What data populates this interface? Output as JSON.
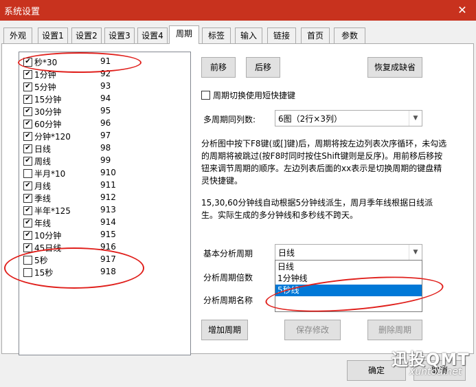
{
  "window": {
    "title": "系统设置",
    "close_glyph": "✕"
  },
  "tabs": [
    {
      "label": "外观"
    },
    {
      "label": "设置1"
    },
    {
      "label": "设置2"
    },
    {
      "label": "设置3"
    },
    {
      "label": "设置4"
    },
    {
      "label": "周期",
      "active": true
    },
    {
      "label": "标签"
    },
    {
      "label": "输入"
    },
    {
      "label": "链接"
    },
    {
      "label": "首页"
    },
    {
      "label": "参数"
    }
  ],
  "periods": [
    {
      "name": "秒*30",
      "key": "91",
      "checked": true
    },
    {
      "name": "1分钟",
      "key": "92",
      "checked": true
    },
    {
      "name": "5分钟",
      "key": "93",
      "checked": true
    },
    {
      "name": "15分钟",
      "key": "94",
      "checked": true
    },
    {
      "name": "30分钟",
      "key": "95",
      "checked": true
    },
    {
      "name": "60分钟",
      "key": "96",
      "checked": true
    },
    {
      "name": "分钟*120",
      "key": "97",
      "checked": true
    },
    {
      "name": "日线",
      "key": "98",
      "checked": true
    },
    {
      "name": "周线",
      "key": "99",
      "checked": true
    },
    {
      "name": "半月*10",
      "key": "910",
      "checked": false
    },
    {
      "name": "月线",
      "key": "911",
      "checked": true
    },
    {
      "name": "季线",
      "key": "912",
      "checked": true
    },
    {
      "name": "半年*125",
      "key": "913",
      "checked": true
    },
    {
      "name": "年线",
      "key": "914",
      "checked": true
    },
    {
      "name": "10分钟",
      "key": "915",
      "checked": true
    },
    {
      "name": "45日线",
      "key": "916",
      "checked": true
    },
    {
      "name": "5秒",
      "key": "917",
      "checked": false
    },
    {
      "name": "15秒",
      "key": "918",
      "checked": false
    }
  ],
  "buttons": {
    "move_up": "前移",
    "move_down": "后移",
    "restore_default": "恢复成缺省",
    "add_period": "增加周期",
    "save_changes": "保存修改",
    "delete_period": "删除周期",
    "ok": "确定",
    "cancel": "取消"
  },
  "shortcut_checkbox": {
    "label": "周期切换使用短快捷键",
    "checked": false
  },
  "multi_period": {
    "label": "多周期同列数:",
    "value": "6图（2行×3列）"
  },
  "description": {
    "para1": "分析图中按下F8键(或[]键)后，周期将按左边列表次序循环，未勾选的周期将被跳过(按F8时同时按住Shift键则是反序)。用前移后移按钮来调节周期的顺序。左边列表后面的xx表示是切换周期的键盘精灵快捷键。",
    "para2": "15,30,60分钟线自动根据5分钟线派生，周月季年线根据日线派生。实际生成的多分钟线和多秒线不跨天。"
  },
  "base_period": {
    "label": "基本分析周期",
    "value": "日线",
    "options": [
      "日线",
      "1分钟线",
      "5秒线"
    ],
    "highlighted_option": "5秒线"
  },
  "multiplier": {
    "label": "分析周期倍数",
    "value": ""
  },
  "period_name": {
    "label": "分析周期名称",
    "value": ""
  },
  "watermark": {
    "brand": "迅投QMT",
    "url": "xuntou.net"
  },
  "colors": {
    "titlebar": "#c8321e",
    "selection": "#0078d7",
    "annotation": "#e0201c"
  }
}
